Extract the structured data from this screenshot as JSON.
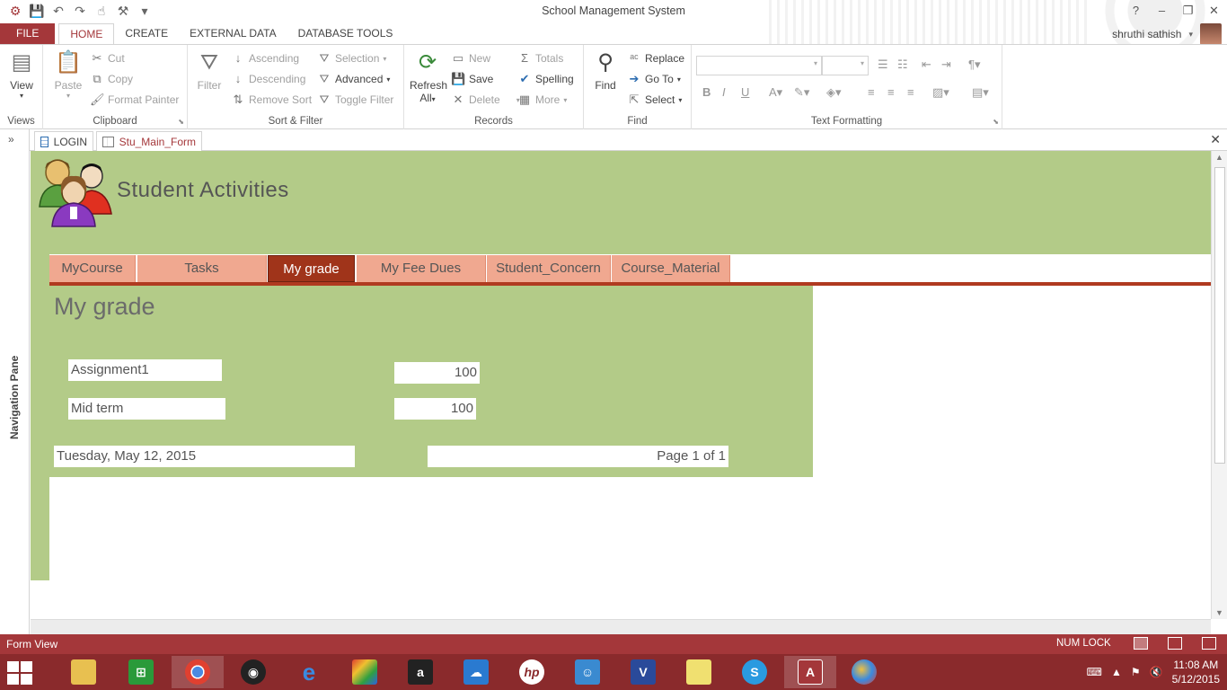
{
  "window": {
    "title": "School Management System",
    "controls": [
      "?",
      "–",
      "❐",
      "✕"
    ]
  },
  "ribbon": {
    "tabs": [
      "FILE",
      "HOME",
      "CREATE",
      "EXTERNAL DATA",
      "DATABASE TOOLS"
    ],
    "active_tab": "HOME",
    "user": "shruthi sathish",
    "groups": {
      "views": {
        "label": "Views",
        "view": "View"
      },
      "clipboard": {
        "label": "Clipboard",
        "paste": "Paste",
        "cut": "Cut",
        "copy": "Copy",
        "format_painter": "Format Painter"
      },
      "sort_filter": {
        "label": "Sort & Filter",
        "filter": "Filter",
        "ascending": "Ascending",
        "descending": "Descending",
        "remove_sort": "Remove Sort",
        "selection": "Selection",
        "advanced": "Advanced",
        "toggle_filter": "Toggle Filter"
      },
      "records": {
        "label": "Records",
        "refresh": "Refresh",
        "refresh_all": "All",
        "new": "New",
        "save": "Save",
        "delete": "Delete",
        "totals": "Totals",
        "spelling": "Spelling",
        "more": "More"
      },
      "find": {
        "label": "Find",
        "find": "Find",
        "replace": "Replace",
        "goto": "Go To",
        "select": "Select"
      },
      "text_formatting": {
        "label": "Text Formatting",
        "bold": "B",
        "italic": "I",
        "underline": "U"
      }
    }
  },
  "navigation_pane": {
    "label": "Navigation Pane",
    "toggle": "»"
  },
  "document_tabs": [
    {
      "label": "LOGIN",
      "type": "table"
    },
    {
      "label": "Stu_Main_Form",
      "type": "form",
      "active": true
    }
  ],
  "form": {
    "title": "Student Activities",
    "tabs": [
      "MyCourse",
      "Tasks",
      "My grade",
      "My Fee Dues",
      "Student_Concern",
      "Course_Material"
    ],
    "active_tab": "My grade",
    "subform": {
      "title": "My grade",
      "rows": [
        {
          "name": "Assignment1",
          "value": "100"
        },
        {
          "name": "Mid term",
          "value": "100"
        }
      ],
      "date": "Tuesday, May 12, 2015",
      "page": "Page 1 of 1"
    }
  },
  "status_bar": {
    "mode": "Form View",
    "num_lock": "NUM LOCK"
  },
  "taskbar": {
    "apps": [
      "file-explorer",
      "store",
      "chrome",
      "media",
      "internet-explorer",
      "puzzle",
      "amazon",
      "onedrive",
      "hp",
      "app",
      "visio",
      "sticky-notes",
      "skype",
      "access",
      "paint"
    ],
    "time": "11:08 AM",
    "date": "5/12/2015"
  },
  "colors": {
    "accent": "#a4373a",
    "form_bg": "#b3cb88",
    "tab": "#f0a890",
    "tab_active": "#a0341a",
    "taskbar": "#8a2a2c"
  }
}
